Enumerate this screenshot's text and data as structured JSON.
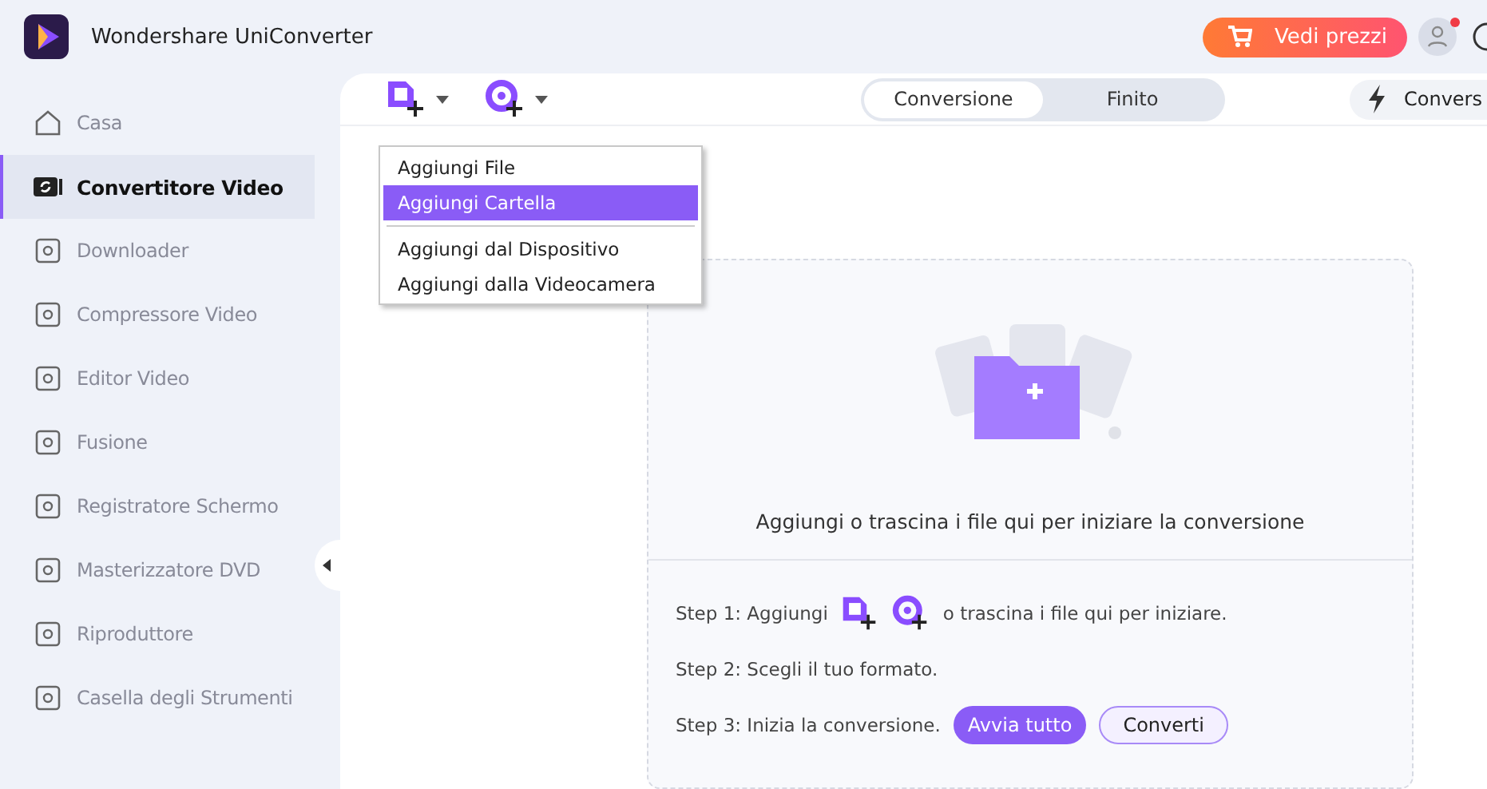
{
  "app": {
    "title": "Wondershare UniConverter"
  },
  "header": {
    "pricing_button": "Vedi prezzi",
    "notification": true
  },
  "sidebar": {
    "items": [
      {
        "label": "Casa",
        "selected": false
      },
      {
        "label": "Convertitore Video",
        "selected": true
      },
      {
        "label": "Downloader",
        "selected": false
      },
      {
        "label": "Compressore Video",
        "selected": false
      },
      {
        "label": "Editor Video",
        "selected": false
      },
      {
        "label": "Fusione",
        "selected": false
      },
      {
        "label": "Registratore Schermo",
        "selected": false
      },
      {
        "label": "Masterizzatore DVD",
        "selected": false
      },
      {
        "label": "Riproduttore",
        "selected": false
      },
      {
        "label": "Casella degli Strumenti",
        "selected": false
      }
    ]
  },
  "tabs": [
    {
      "label": "Conversione",
      "selected": true
    },
    {
      "label": "Finito",
      "selected": false
    }
  ],
  "turbo_button": "Convers",
  "add_menu": {
    "groups": [
      [
        {
          "label": "Aggiungi File",
          "selected": false
        },
        {
          "label": "Aggiungi Cartella",
          "selected": true
        }
      ],
      [
        {
          "label": "Aggiungi dal Dispositivo",
          "selected": false
        },
        {
          "label": "Aggiungi dalla Videocamera",
          "selected": false
        }
      ]
    ]
  },
  "drop_zone": {
    "caption": "Aggiungi o trascina i file qui per iniziare la conversione",
    "step1_before": "Step 1: Aggiungi",
    "step1_after": "o trascina i file qui per iniziare.",
    "step2": "Step 2: Scegli il tuo formato.",
    "step3": "Step 3: Inizia la conversione.",
    "start_all_button": "Avvia tutto",
    "convert_button": "Converti"
  }
}
